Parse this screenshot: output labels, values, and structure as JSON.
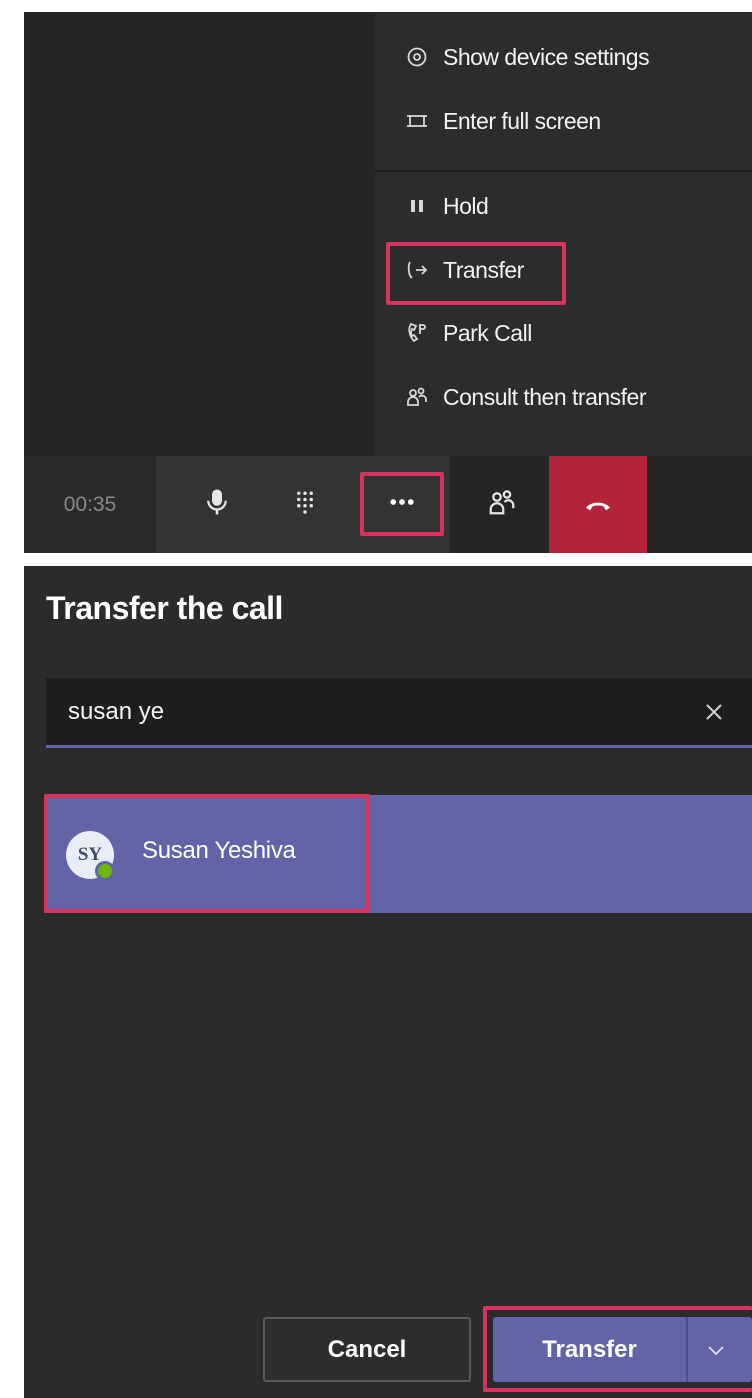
{
  "call_menu": {
    "items": [
      {
        "label": "Show device settings",
        "icon": "settings-gear-icon"
      },
      {
        "label": "Enter full screen",
        "icon": "fullscreen-icon"
      },
      {
        "label": "Hold",
        "icon": "pause-icon"
      },
      {
        "label": "Transfer",
        "icon": "transfer-call-icon"
      },
      {
        "label": "Park Call",
        "icon": "park-call-icon"
      },
      {
        "label": "Consult then transfer",
        "icon": "consult-transfer-icon"
      }
    ]
  },
  "call_toolbar": {
    "timer": "00:35",
    "buttons": [
      "microphone-icon",
      "dialpad-icon",
      "more-options-icon",
      "people-icon",
      "hang-up-icon"
    ]
  },
  "transfer_dialog": {
    "title": "Transfer the call",
    "search_value": "susan ye",
    "result": {
      "initials": "SY",
      "name": "Susan Yeshiva",
      "presence": "available"
    },
    "cancel_label": "Cancel",
    "transfer_label": "Transfer"
  },
  "colors": {
    "accent": "#6264a7",
    "highlight_border": "#d8335c",
    "end_call": "#b3233b",
    "presence_available": "#6bb700"
  }
}
